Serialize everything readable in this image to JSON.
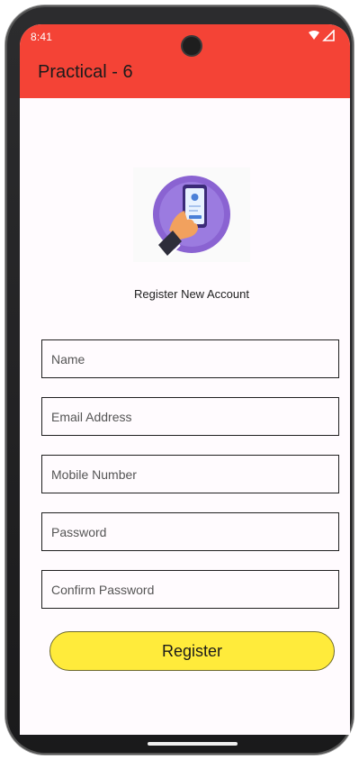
{
  "status_bar": {
    "time": "8:41"
  },
  "app_bar": {
    "title": "Practical - 6"
  },
  "form": {
    "subtitle": "Register New Account",
    "fields": {
      "name": {
        "placeholder": "Name",
        "value": ""
      },
      "email": {
        "placeholder": "Email Address",
        "value": ""
      },
      "mobile": {
        "placeholder": "Mobile Number",
        "value": ""
      },
      "password": {
        "placeholder": "Password",
        "value": ""
      },
      "confirm_password": {
        "placeholder": "Confirm Password",
        "value": ""
      }
    },
    "register_label": "Register"
  },
  "icons": {
    "status": [
      "wifi-icon",
      "signal-icon"
    ],
    "logo": "phone-in-hand-icon"
  },
  "colors": {
    "app_bar": "#f44336",
    "button": "#ffeb3b",
    "logo_circle": "#8a63d2",
    "screen_bg": "#fffbfe"
  }
}
